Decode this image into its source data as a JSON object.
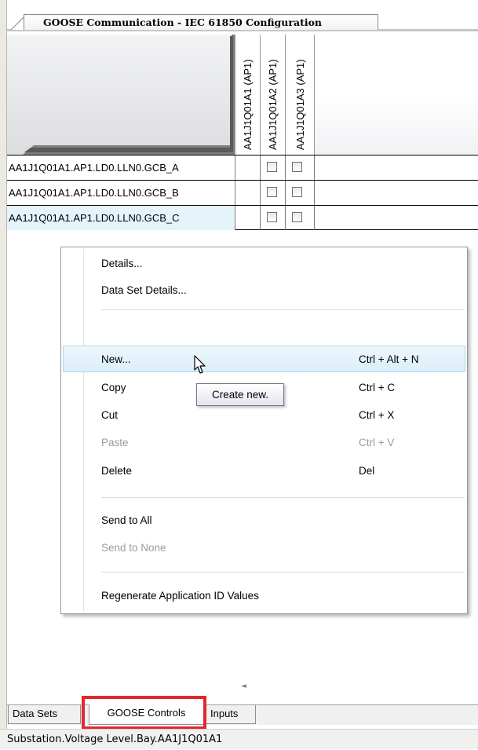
{
  "document_tab": {
    "title": "GOOSE Communication - IEC 61850 Configuration"
  },
  "columns": [
    {
      "label": "AA1J1Q01A1 (AP1)"
    },
    {
      "label": "AA1J1Q01A2 (AP1)"
    },
    {
      "label": "AA1J1Q01A3 (AP1)"
    }
  ],
  "rows": [
    {
      "label": "AA1J1Q01A1.AP1.LD0.LLN0.GCB_A"
    },
    {
      "label": "AA1J1Q01A1.AP1.LD0.LLN0.GCB_B"
    },
    {
      "label": "AA1J1Q01A1.AP1.LD0.LLN0.GCB_C"
    }
  ],
  "context_menu": {
    "items": [
      {
        "label": "Details...",
        "shortcut": ""
      },
      {
        "label": "Data Set Details...",
        "shortcut": ""
      },
      {
        "label": "New...",
        "shortcut": "Ctrl + Alt + N"
      },
      {
        "label": "Copy",
        "shortcut": "Ctrl + C"
      },
      {
        "label": "Cut",
        "shortcut": "Ctrl + X"
      },
      {
        "label": "Paste",
        "shortcut": "Ctrl + V"
      },
      {
        "label": "Delete",
        "shortcut": "Del"
      },
      {
        "label": "Send to All",
        "shortcut": ""
      },
      {
        "label": "Send to None",
        "shortcut": ""
      },
      {
        "label": "Regenerate Application ID Values",
        "shortcut": ""
      }
    ]
  },
  "tooltip": {
    "text": "Create new."
  },
  "bottom_tabs": [
    {
      "label": "Data Sets"
    },
    {
      "label": "GOOSE Controls"
    },
    {
      "label": "Inputs"
    }
  ],
  "status_bar": {
    "text": "Substation.Voltage Level.Bay.AA1J1Q01A1"
  },
  "colors": {
    "highlight": "#e0282e",
    "selection": "#e5f3fb",
    "menu_hover_border": "#a8d8f1"
  }
}
